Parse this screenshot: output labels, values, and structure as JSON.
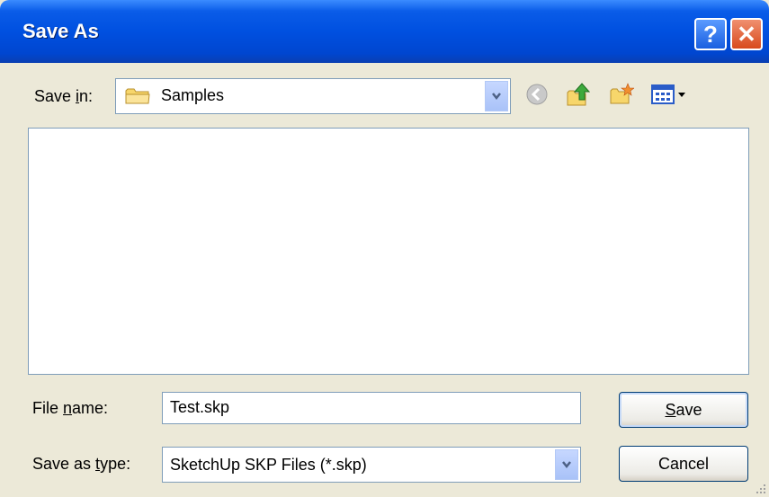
{
  "window": {
    "title": "Save As"
  },
  "titlebar": {
    "help_glyph": "?",
    "close_glyph": "✕"
  },
  "save_in": {
    "label_prefix": "Save ",
    "label_accel": "i",
    "label_suffix": "n:",
    "value": "Samples",
    "icon": "folder-icon"
  },
  "toolbar": {
    "icons": [
      "back-icon",
      "up-folder-icon",
      "new-folder-icon",
      "view-menu-icon"
    ]
  },
  "file_name": {
    "label_prefix": "File ",
    "label_accel": "n",
    "label_suffix": "ame:",
    "value": "Test.skp"
  },
  "save_as_type": {
    "label_prefix": "Save as ",
    "label_accel": "t",
    "label_suffix": "ype:",
    "value": "SketchUp SKP Files (*.skp)"
  },
  "buttons": {
    "save_accel": "S",
    "save_rest": "ave",
    "cancel_label": "Cancel"
  },
  "colors": {
    "titlebar": "#0050E0",
    "dialog_bg": "#ECE9D8",
    "border": "#7F9DB9"
  }
}
